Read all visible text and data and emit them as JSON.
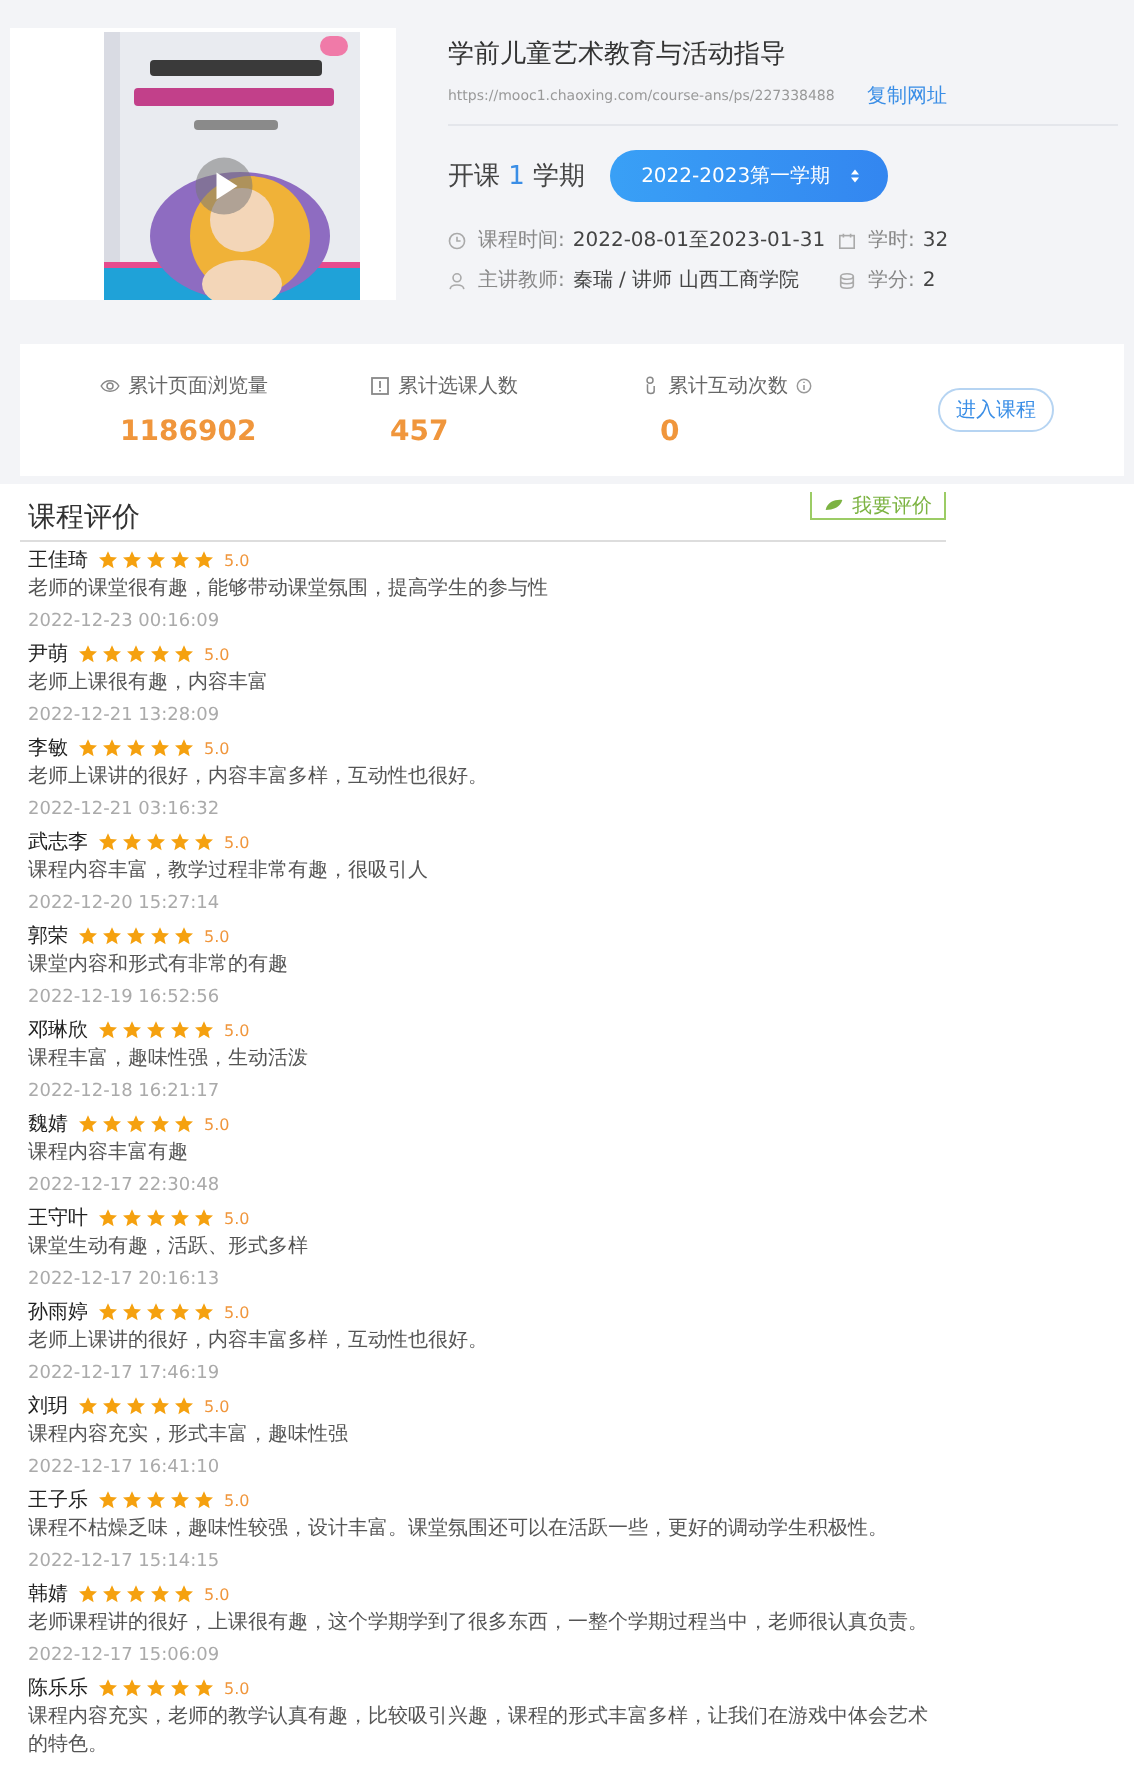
{
  "course": {
    "title": "学前儿童艺术教育与活动指导",
    "url": "https://mooc1.chaoxing.com/course-ans/ps/227338488",
    "copy_link": "复制网址",
    "term_prefix": "开课",
    "term_count": "1",
    "term_suffix": "学期",
    "term_select": "2022-2023第一学期",
    "info": [
      {
        "kind": "time",
        "label": "课程时间:",
        "value": "2022-08-01至2023-01-31"
      },
      {
        "kind": "hours",
        "label": "学时:",
        "value": "32"
      },
      {
        "kind": "teacher",
        "label": "主讲教师:",
        "value": "秦瑞 / 讲师  山西工商学院"
      },
      {
        "kind": "credits",
        "label": "学分:",
        "value": "2"
      }
    ]
  },
  "stats": {
    "items": [
      {
        "kind": "views",
        "label": "累计页面浏览量",
        "value": "1186902"
      },
      {
        "kind": "students",
        "label": "累计选课人数",
        "value": "457"
      },
      {
        "kind": "interactions",
        "label": "累计互动次数",
        "value": "0",
        "help": true
      }
    ],
    "enter_button": "进入课程"
  },
  "reviews": {
    "title": "课程评价",
    "write_button": "我要评价",
    "items": [
      {
        "name": "王佳琦",
        "stars": 5,
        "score": "5.0",
        "comment": "老师的课堂很有趣，能够带动课堂氛围，提高学生的参与性",
        "date": "2022-12-23 00:16:09"
      },
      {
        "name": "尹萌",
        "stars": 5,
        "score": "5.0",
        "comment": "老师上课很有趣，内容丰富",
        "date": "2022-12-21 13:28:09"
      },
      {
        "name": "李敏",
        "stars": 5,
        "score": "5.0",
        "comment": "老师上课讲的很好，内容丰富多样，互动性也很好。",
        "date": "2022-12-21 03:16:32"
      },
      {
        "name": "武志李",
        "stars": 5,
        "score": "5.0",
        "comment": "课程内容丰富，教学过程非常有趣，很吸引人",
        "date": "2022-12-20 15:27:14"
      },
      {
        "name": "郭荣",
        "stars": 5,
        "score": "5.0",
        "comment": "课堂内容和形式有非常的有趣",
        "date": "2022-12-19 16:52:56"
      },
      {
        "name": "邓琳欣",
        "stars": 5,
        "score": "5.0",
        "comment": "课程丰富，趣味性强，生动活泼",
        "date": "2022-12-18 16:21:17"
      },
      {
        "name": "魏婧",
        "stars": 5,
        "score": "5.0",
        "comment": "课程内容丰富有趣",
        "date": "2022-12-17 22:30:48"
      },
      {
        "name": "王守叶",
        "stars": 5,
        "score": "5.0",
        "comment": "课堂生动有趣，活跃、形式多样",
        "date": "2022-12-17 20:16:13"
      },
      {
        "name": "孙雨婷",
        "stars": 5,
        "score": "5.0",
        "comment": "老师上课讲的很好，内容丰富多样，互动性也很好。",
        "date": "2022-12-17 17:46:19"
      },
      {
        "name": "刘玥",
        "stars": 5,
        "score": "5.0",
        "comment": "课程内容充实，形式丰富，趣味性强",
        "date": "2022-12-17 16:41:10"
      },
      {
        "name": "王子乐",
        "stars": 5,
        "score": "5.0",
        "comment": "课程不枯燥乏味，趣味性较强，设计丰富。课堂氛围还可以在活跃一些，更好的调动学生积极性。",
        "date": "2022-12-17 15:14:15"
      },
      {
        "name": "韩婧",
        "stars": 5,
        "score": "5.0",
        "comment": "老师课程讲的很好，上课很有趣，这个学期学到了很多东西，一整个学期过程当中，老师很认真负责。",
        "date": "2022-12-17 15:06:09"
      },
      {
        "name": "陈乐乐",
        "stars": 5,
        "score": "5.0",
        "comment": "课程内容充实，老师的教学认真有趣，比较吸引兴趣，课程的形式丰富多样，让我们在游戏中体会艺术的特色。"
      }
    ]
  }
}
